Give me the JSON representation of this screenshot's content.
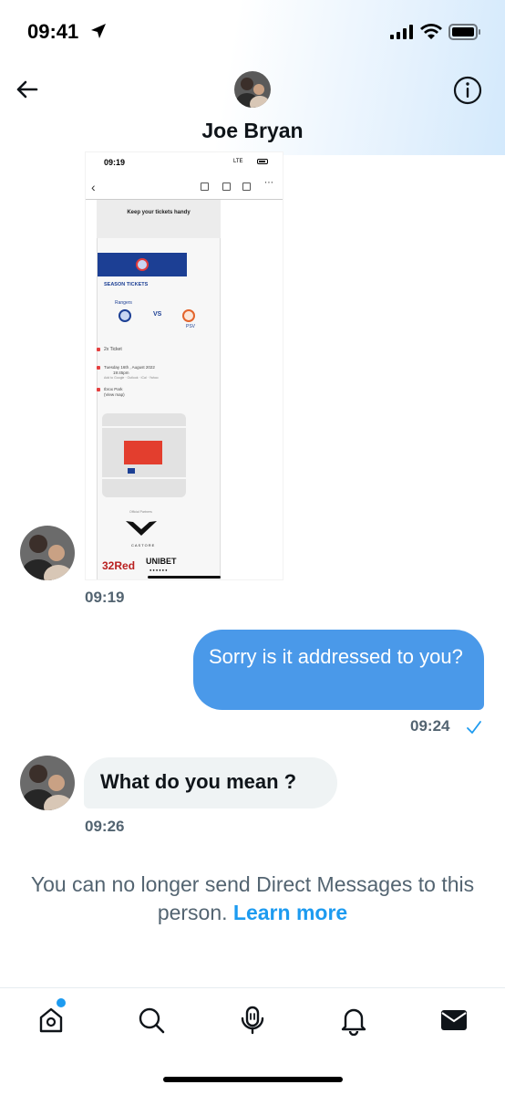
{
  "status_bar": {
    "time": "09:41",
    "icons": [
      "location-arrow-icon",
      "signal-icon",
      "wifi-icon",
      "battery-icon"
    ]
  },
  "header": {
    "name": "Joe Bryan",
    "back_icon": "arrow-left-icon",
    "info_icon": "info-icon"
  },
  "attachment": {
    "status_time": "09:19",
    "status_network": "LTE",
    "headline": "Keep your tickets handy",
    "section": "SEASON TICKETS",
    "home_team": "Rangers",
    "versus": "VS",
    "away_team": "PSV",
    "ticket_count": "2x Ticket",
    "date": "Tuesday 16th , August 2022",
    "kickoff": "19:45pm",
    "calendar": "Add to Google · Outlook · iCal · Yahoo",
    "venue": "Ibrox Park",
    "venue_map": "(View map)",
    "partners": "Official Partners",
    "brand_1": "CASTORE",
    "brand_2": "32Red",
    "brand_3": "UNIBET",
    "brand_3_sub": "●●●●●●"
  },
  "messages": [
    {
      "direction": "incoming",
      "type": "image",
      "time": "09:19"
    },
    {
      "direction": "outgoing",
      "text": "Sorry is it addressed to you?",
      "time": "09:24",
      "status_icon": "checkmark-icon"
    },
    {
      "direction": "incoming",
      "text": "What do you mean ?",
      "time": "09:26"
    }
  ],
  "notice": {
    "text": "You can no longer send Direct Messages to this person.",
    "link": "Learn more"
  },
  "bottom_nav": [
    {
      "icon": "home-icon",
      "has_notification_dot": true
    },
    {
      "icon": "search-icon"
    },
    {
      "icon": "spaces-microphone-icon"
    },
    {
      "icon": "bell-icon"
    },
    {
      "icon": "mail-icon",
      "active": true
    }
  ],
  "colors": {
    "accent": "#1d9bf0",
    "outgoing_bubble": "#4a99e9",
    "incoming_bubble": "#eff3f4",
    "secondary_text": "#536471"
  }
}
